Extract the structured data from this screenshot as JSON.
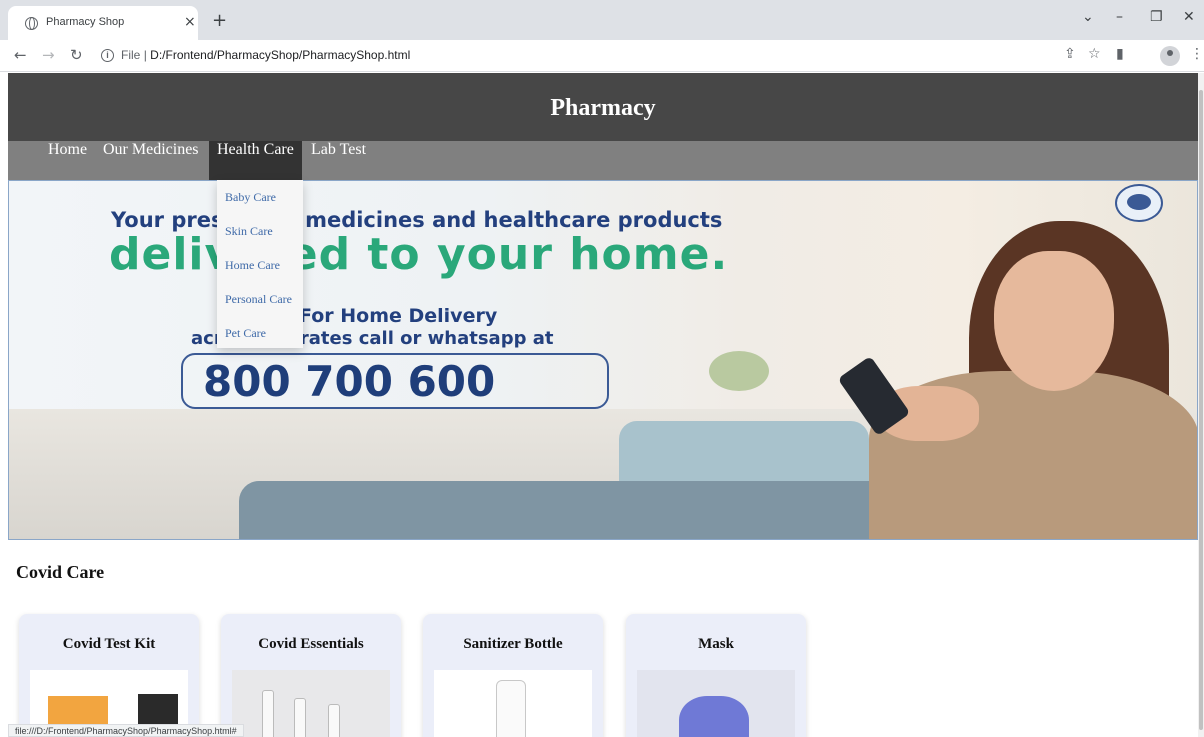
{
  "browser": {
    "tab_title": "Pharmacy Shop",
    "tab_close": "×",
    "new_tab": "+",
    "url_scheme": "File",
    "url_separator": "|",
    "url_path": "D:/Frontend/PharmacyShop/PharmacyShop.html",
    "status_url": "file:///D:/Frontend/PharmacyShop/PharmacyShop.html#"
  },
  "site": {
    "title": "Pharmacy"
  },
  "nav": {
    "items": [
      {
        "label": "Home"
      },
      {
        "label": "Our Medicines"
      },
      {
        "label": "Health Care"
      },
      {
        "label": "Lab Test"
      }
    ],
    "active": "Health Care",
    "dropdown": [
      "Baby Care",
      "Skin Care",
      "Home Care",
      "Personal Care",
      "Pet Care"
    ]
  },
  "hero": {
    "line1": "Your prescribed medicines and healthcare products",
    "line2": "delivered to your home.",
    "line3": "For Home Delivery",
    "line4": "across emirates call or whatsapp at",
    "phone": "800 700 600"
  },
  "section": {
    "title": "Covid Care"
  },
  "products": [
    {
      "name": "Covid Test Kit"
    },
    {
      "name": "Covid Essentials"
    },
    {
      "name": "Sanitizer Bottle"
    },
    {
      "name": "Mask"
    }
  ],
  "colors": {
    "header_bg": "#474747",
    "nav_bg": "#808080",
    "nav_active_bg": "#333333",
    "dropdown_link": "#3f6aa8",
    "hero_blue": "#23407e",
    "hero_green": "#2aa87a",
    "card_bg": "#ebeef9"
  }
}
